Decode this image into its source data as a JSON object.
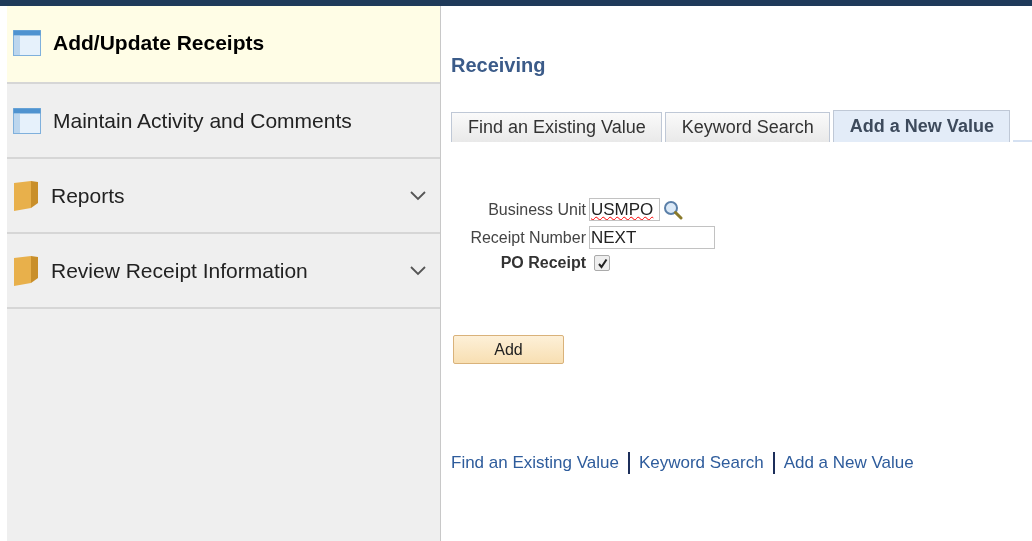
{
  "sidebar": {
    "items": [
      {
        "label": "Add/Update Receipts",
        "kind": "page",
        "selected": true
      },
      {
        "label": "Maintain Activity and Comments",
        "kind": "page",
        "selected": false
      },
      {
        "label": "Reports",
        "kind": "folder",
        "selected": false,
        "expanded": false
      },
      {
        "label": "Review Receipt Information",
        "kind": "folder",
        "selected": false,
        "expanded": false
      }
    ]
  },
  "page_title": "Receiving",
  "tabs": [
    {
      "label": "Find an Existing Value",
      "selected": false
    },
    {
      "label": "Keyword Search",
      "selected": false
    },
    {
      "label": "Add a New Value",
      "selected": true
    }
  ],
  "form": {
    "business_unit": {
      "label": "Business Unit",
      "value": "USMPO"
    },
    "receipt_number": {
      "label": "Receipt Number",
      "value": "NEXT"
    },
    "po_receipt": {
      "label": "PO Receipt",
      "checked": true
    }
  },
  "add_button": "Add",
  "footer_links": [
    "Find an Existing Value",
    "Keyword Search",
    "Add a New Value"
  ]
}
